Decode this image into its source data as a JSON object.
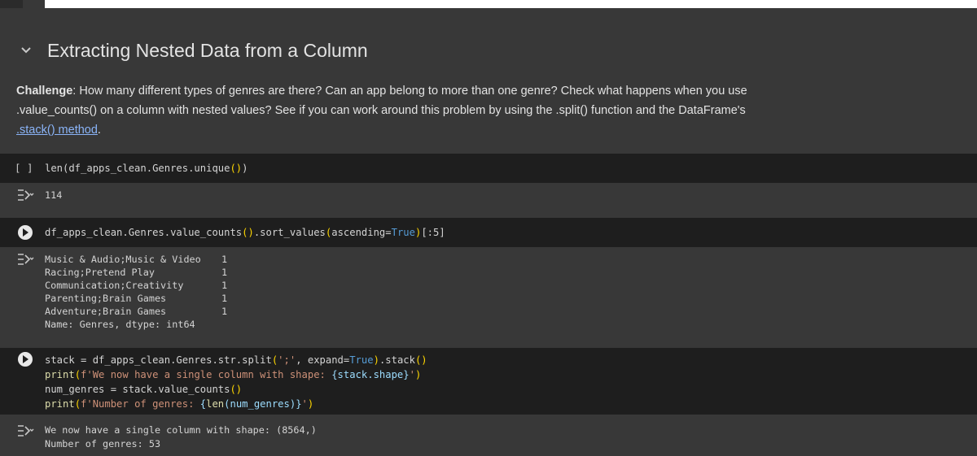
{
  "section": {
    "title": "Extracting Nested Data from a Column"
  },
  "challenge": {
    "label": "Challenge",
    "text_1": ": How many different types of genres are there? Can an app belong to more than one genre? Check what happens when you use .value_counts() on a column with nested values? See if you can work around this problem by using the .split() function and the DataFrame's ",
    "link": ".stack() method",
    "text_2": "."
  },
  "cells": [
    {
      "bracket": "[ ]",
      "code": "len(df_apps_clean.Genres.unique())",
      "output": "114"
    },
    {
      "code": "df_apps_clean.Genres.value_counts().sort_values(ascending=True)[:5]",
      "output_rows": [
        {
          "label": "Music & Audio;Music & Video",
          "value": "1"
        },
        {
          "label": "Racing;Pretend Play",
          "value": "1"
        },
        {
          "label": "Communication;Creativity",
          "value": "1"
        },
        {
          "label": "Parenting;Brain Games",
          "value": "1"
        },
        {
          "label": "Adventure;Brain Games",
          "value": "1"
        }
      ],
      "output_footer": "Name: Genres, dtype: int64"
    },
    {
      "code_lines": [
        "stack = df_apps_clean.Genres.str.split(';', expand=True).stack()",
        "print(f'We now have a single column with shape: {stack.shape}')",
        "num_genres = stack.value_counts()",
        "print(f'Number of genres: {len(num_genres)}')"
      ],
      "output_lines": [
        "We now have a single column with shape: (8564,)",
        "Number of genres: 53"
      ]
    }
  ],
  "colors": {
    "background": "#383838",
    "code_cell": "#1e1e1e",
    "keyword": "#569cd6",
    "string": "#ce9178",
    "link": "#8ab4f8"
  },
  "icons": {
    "collapse": "chevron-down-icon",
    "run": "play-icon",
    "output": "output-toggle-icon"
  }
}
